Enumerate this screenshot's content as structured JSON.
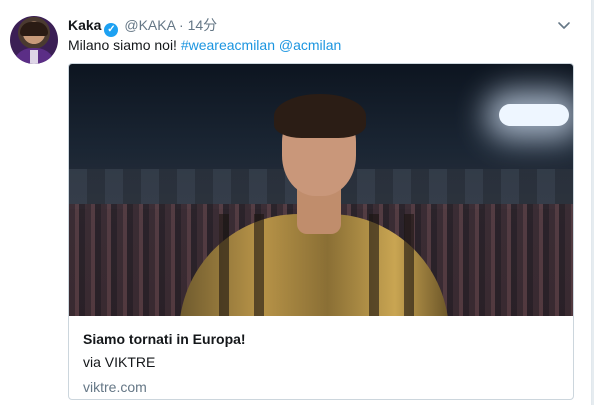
{
  "tweet": {
    "author_name": "Kaka",
    "handle": "@KAKA",
    "separator": "·",
    "time": "14分",
    "text_plain": "Milano siamo noi!",
    "hashtag": "#weareacmilan",
    "mention": "@acmilan"
  },
  "card": {
    "title": "Siamo tornati in Europa!",
    "description": "via VIKTRE",
    "domain": "viktre.com"
  },
  "colors": {
    "link": "#1b95e0",
    "verified": "#1da1f2",
    "secondary_text": "#657786"
  },
  "icons": {
    "verified": "verified-badge-icon",
    "caret": "chevron-down-icon"
  }
}
